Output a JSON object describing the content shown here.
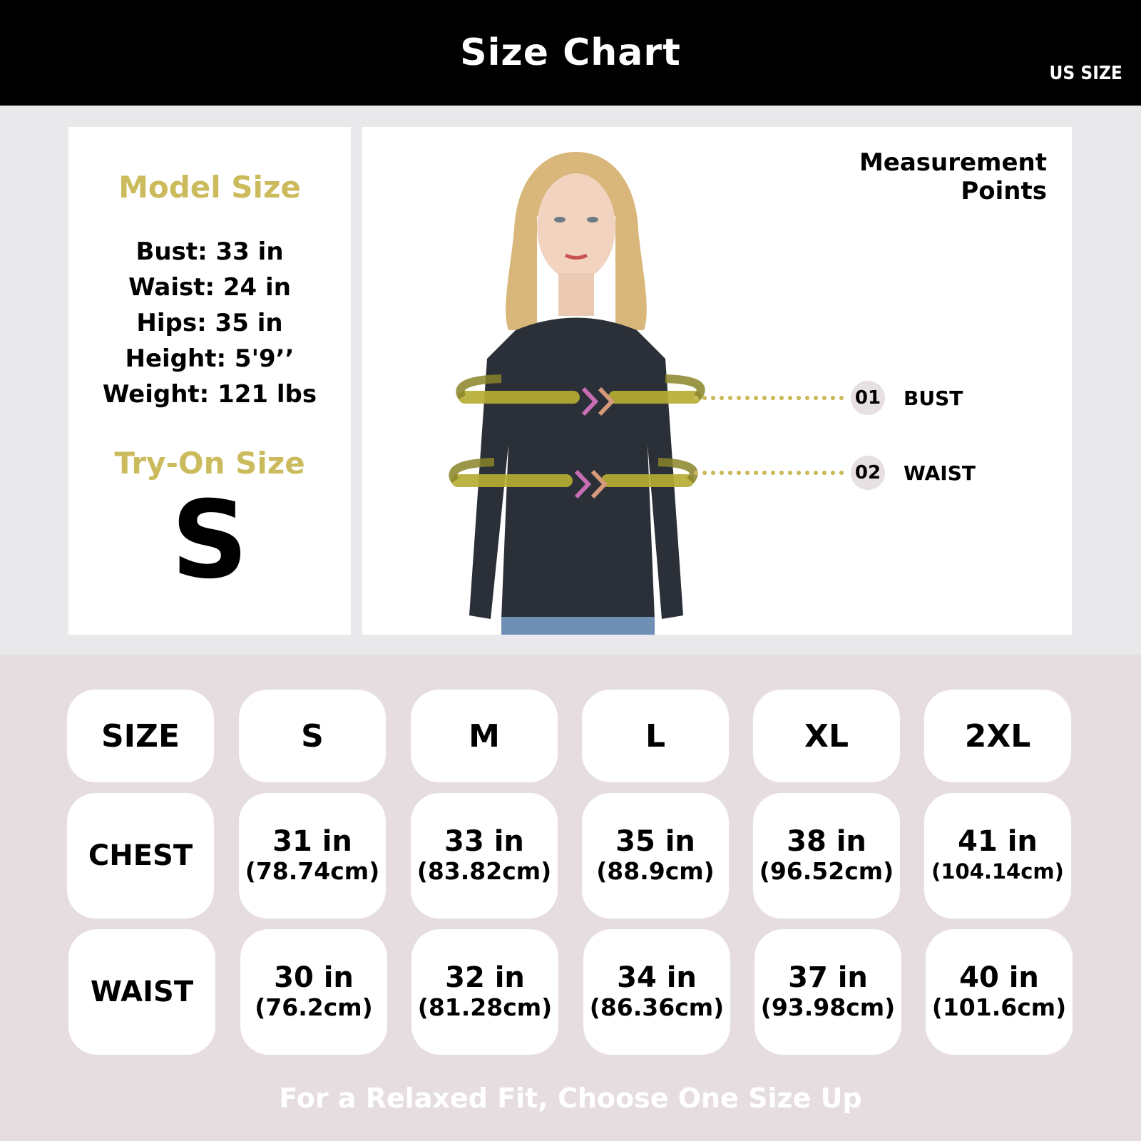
{
  "header": {
    "title": "Size Chart",
    "region": "US SIZE"
  },
  "model": {
    "title": "Model Size",
    "stats": [
      "Bust: 33 in",
      "Waist: 24 in",
      "Hips: 35 in",
      "Height: 5'9’’",
      "Weight: 121 lbs"
    ],
    "tryon_title": "Try-On Size",
    "tryon_size": "S"
  },
  "measurement": {
    "title_line1": "Measurement",
    "title_line2": "Points",
    "points": [
      {
        "num": "01",
        "label": "BUST"
      },
      {
        "num": "02",
        "label": "WAIST"
      }
    ]
  },
  "table": {
    "header_label": "SIZE",
    "sizes": [
      "S",
      "M",
      "L",
      "XL",
      "2XL"
    ],
    "rows": [
      {
        "label": "CHEST",
        "values": [
          {
            "in": "31 in",
            "cm": "(78.74cm)"
          },
          {
            "in": "33 in",
            "cm": "(83.82cm)"
          },
          {
            "in": "35 in",
            "cm": "(88.9cm)"
          },
          {
            "in": "38 in",
            "cm": "(96.52cm)"
          },
          {
            "in": "41 in",
            "cm": "(104.14cm)"
          }
        ]
      },
      {
        "label": "WAIST",
        "values": [
          {
            "in": "30 in",
            "cm": "(76.2cm)"
          },
          {
            "in": "32 in",
            "cm": "(81.28cm)"
          },
          {
            "in": "34 in",
            "cm": "(86.36cm)"
          },
          {
            "in": "37 in",
            "cm": "(93.98cm)"
          },
          {
            "in": "40 in",
            "cm": "(101.6cm)"
          }
        ]
      }
    ]
  },
  "footer": "For a Relaxed Fit, Choose One Size Up",
  "colors": {
    "accent_gold": "#cbbb5c",
    "header_bg": "#000000",
    "table_bg": "#e6dde1",
    "arrow_pink": "#c870b0"
  }
}
